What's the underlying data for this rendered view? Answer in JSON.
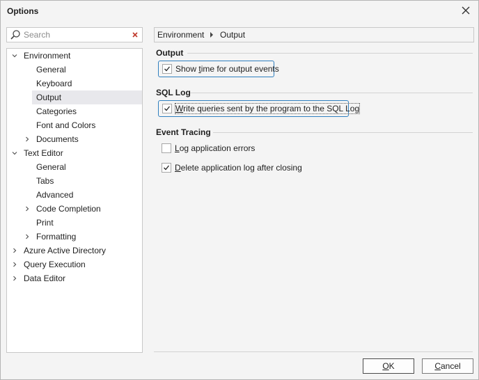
{
  "window": {
    "title": "Options"
  },
  "search": {
    "placeholder": "Search"
  },
  "tree": [
    {
      "label": "Environment",
      "expanded": true,
      "level": 0
    },
    {
      "label": "General",
      "level": 1
    },
    {
      "label": "Keyboard",
      "level": 1
    },
    {
      "label": "Output",
      "level": 1,
      "selected": true
    },
    {
      "label": "Categories",
      "level": 1
    },
    {
      "label": "Font and Colors",
      "level": 1
    },
    {
      "label": "Documents",
      "level": 1,
      "collapsed": true
    },
    {
      "label": "Text Editor",
      "expanded": true,
      "level": 0
    },
    {
      "label": "General",
      "level": 1
    },
    {
      "label": "Tabs",
      "level": 1
    },
    {
      "label": "Advanced",
      "level": 1
    },
    {
      "label": "Code Completion",
      "level": 1,
      "collapsed": true
    },
    {
      "label": "Print",
      "level": 1
    },
    {
      "label": "Formatting",
      "level": 1,
      "collapsed": true
    },
    {
      "label": "Azure Active Directory",
      "level": 0,
      "collapsed": true
    },
    {
      "label": "Query Execution",
      "level": 0,
      "collapsed": true
    },
    {
      "label": "Data Editor",
      "level": 0,
      "collapsed": true
    }
  ],
  "breadcrumb": {
    "parent": "Environment",
    "current": "Output"
  },
  "sections": {
    "output": {
      "title": "Output",
      "show_time": {
        "pre": "Show ",
        "key": "t",
        "post": "ime for output events",
        "checked": true
      }
    },
    "sql_log": {
      "title": "SQL Log",
      "write_queries": {
        "pre": "",
        "key": "W",
        "post": "rite queries sent by the program to the SQL Log",
        "checked": true
      }
    },
    "event_tracing": {
      "title": "Event Tracing",
      "log_errors": {
        "pre": "",
        "key": "L",
        "post": "og application errors",
        "checked": false
      },
      "delete_log": {
        "pre": "",
        "key": "D",
        "post": "elete application log after closing",
        "checked": true
      }
    }
  },
  "buttons": {
    "ok": {
      "key": "O",
      "rest": "K"
    },
    "cancel": {
      "key": "C",
      "rest": "ancel"
    }
  },
  "colors": {
    "focus_border": "#2f7fbf",
    "selected_row": "#e8e8ec",
    "clear_icon": "#c0392b"
  }
}
